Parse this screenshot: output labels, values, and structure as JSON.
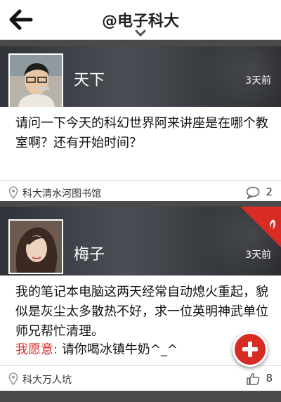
{
  "header": {
    "title": "@电子科大",
    "back_icon": "arrow-left-icon",
    "dropdown_icon": "chevron-down-icon"
  },
  "posts": [
    {
      "author": "天下",
      "time": "3天前",
      "content": "请问一下今天的科幻世界阿来讲座是在哪个教室啊？还有开始时间？",
      "location": "科大清水河图书馆",
      "count_icon": "comment-icon",
      "count": "2"
    },
    {
      "author": "梅子",
      "time": "3天前",
      "content": "我的笔记本电脑这两天经常自动熄火重起，貌似是灰尘太多散热不好，求一位英明神武单位师兄帮忙清理。",
      "wish_label": "我愿意:",
      "wish_text": "请你喝冰镇牛奶^_^",
      "location": "科大万人坑",
      "count_icon": "thumbs-up-icon",
      "count": "8",
      "hot_icon": "flame-icon"
    }
  ],
  "fab": {
    "icon": "plus-icon"
  },
  "colors": {
    "accent": "#d9302b",
    "fab": "#d72b24"
  }
}
